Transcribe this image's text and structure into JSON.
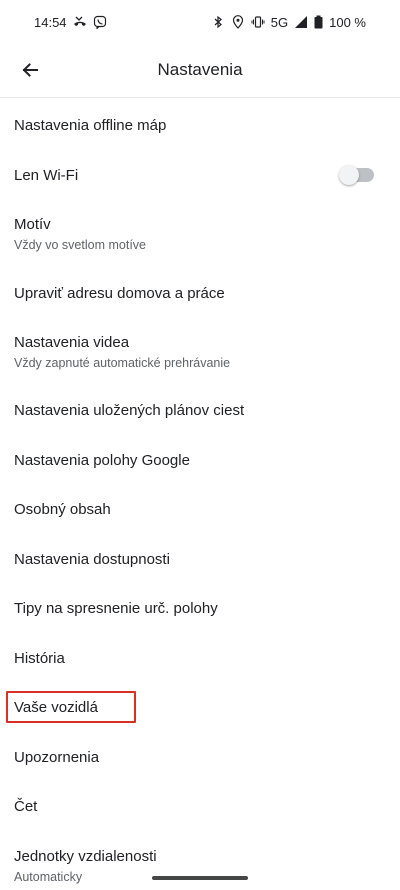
{
  "status_bar": {
    "time": "14:54",
    "network": "5G",
    "battery": "100 %",
    "left_icons": [
      "missed-call-icon",
      "viber-icon"
    ],
    "right_icons": [
      "bluetooth-icon",
      "location-icon",
      "vibrate-icon",
      "signal-icon",
      "battery-icon"
    ]
  },
  "app_bar": {
    "title": "Nastavenia",
    "back_icon": "arrow-back-icon"
  },
  "settings": {
    "items": [
      {
        "title": "Nastavenia offline máp"
      },
      {
        "title": "Len Wi-Fi",
        "toggle": false
      },
      {
        "title": "Motív",
        "subtitle": "Vždy vo svetlom motíve"
      },
      {
        "title": "Upraviť adresu domova a práce"
      },
      {
        "title": "Nastavenia videa",
        "subtitle": "Vždy zapnuté automatické prehrávanie"
      },
      {
        "title": "Nastavenia uložených plánov ciest"
      },
      {
        "title": "Nastavenia polohy Google"
      },
      {
        "title": "Osobný obsah"
      },
      {
        "title": "Nastavenia dostupnosti"
      },
      {
        "title": "Tipy na spresnenie urč. polohy"
      },
      {
        "title": "História"
      },
      {
        "title": "Vaše vozidlá",
        "highlighted": true
      },
      {
        "title": "Upozornenia"
      },
      {
        "title": "Čet"
      },
      {
        "title": "Jednotky vzdialenosti",
        "subtitle": "Automaticky"
      }
    ]
  },
  "colors": {
    "text_primary": "#202124",
    "text_secondary": "#5f6368",
    "highlight": "#d93025",
    "toggle_track": "#bdc1c6"
  }
}
